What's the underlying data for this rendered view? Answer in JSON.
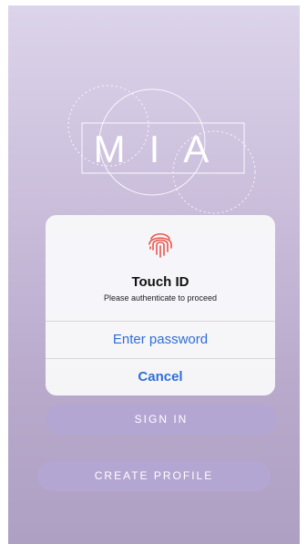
{
  "app": {
    "logo_text": "MIA"
  },
  "touch_id_dialog": {
    "icon": "fingerprint-icon",
    "title": "Touch ID",
    "subtitle": "Please authenticate to proceed",
    "enter_password_label": "Enter password",
    "cancel_label": "Cancel"
  },
  "buttons": {
    "sign_in_label": "SIGN IN",
    "create_profile_label": "CREATE PROFILE"
  },
  "colors": {
    "background_top": "#dcd4ea",
    "background_bottom": "#aea0c3",
    "button_fill": "#b4a6d3",
    "dialog_link": "#2f6fd6",
    "fingerprint": "#e8554a"
  }
}
